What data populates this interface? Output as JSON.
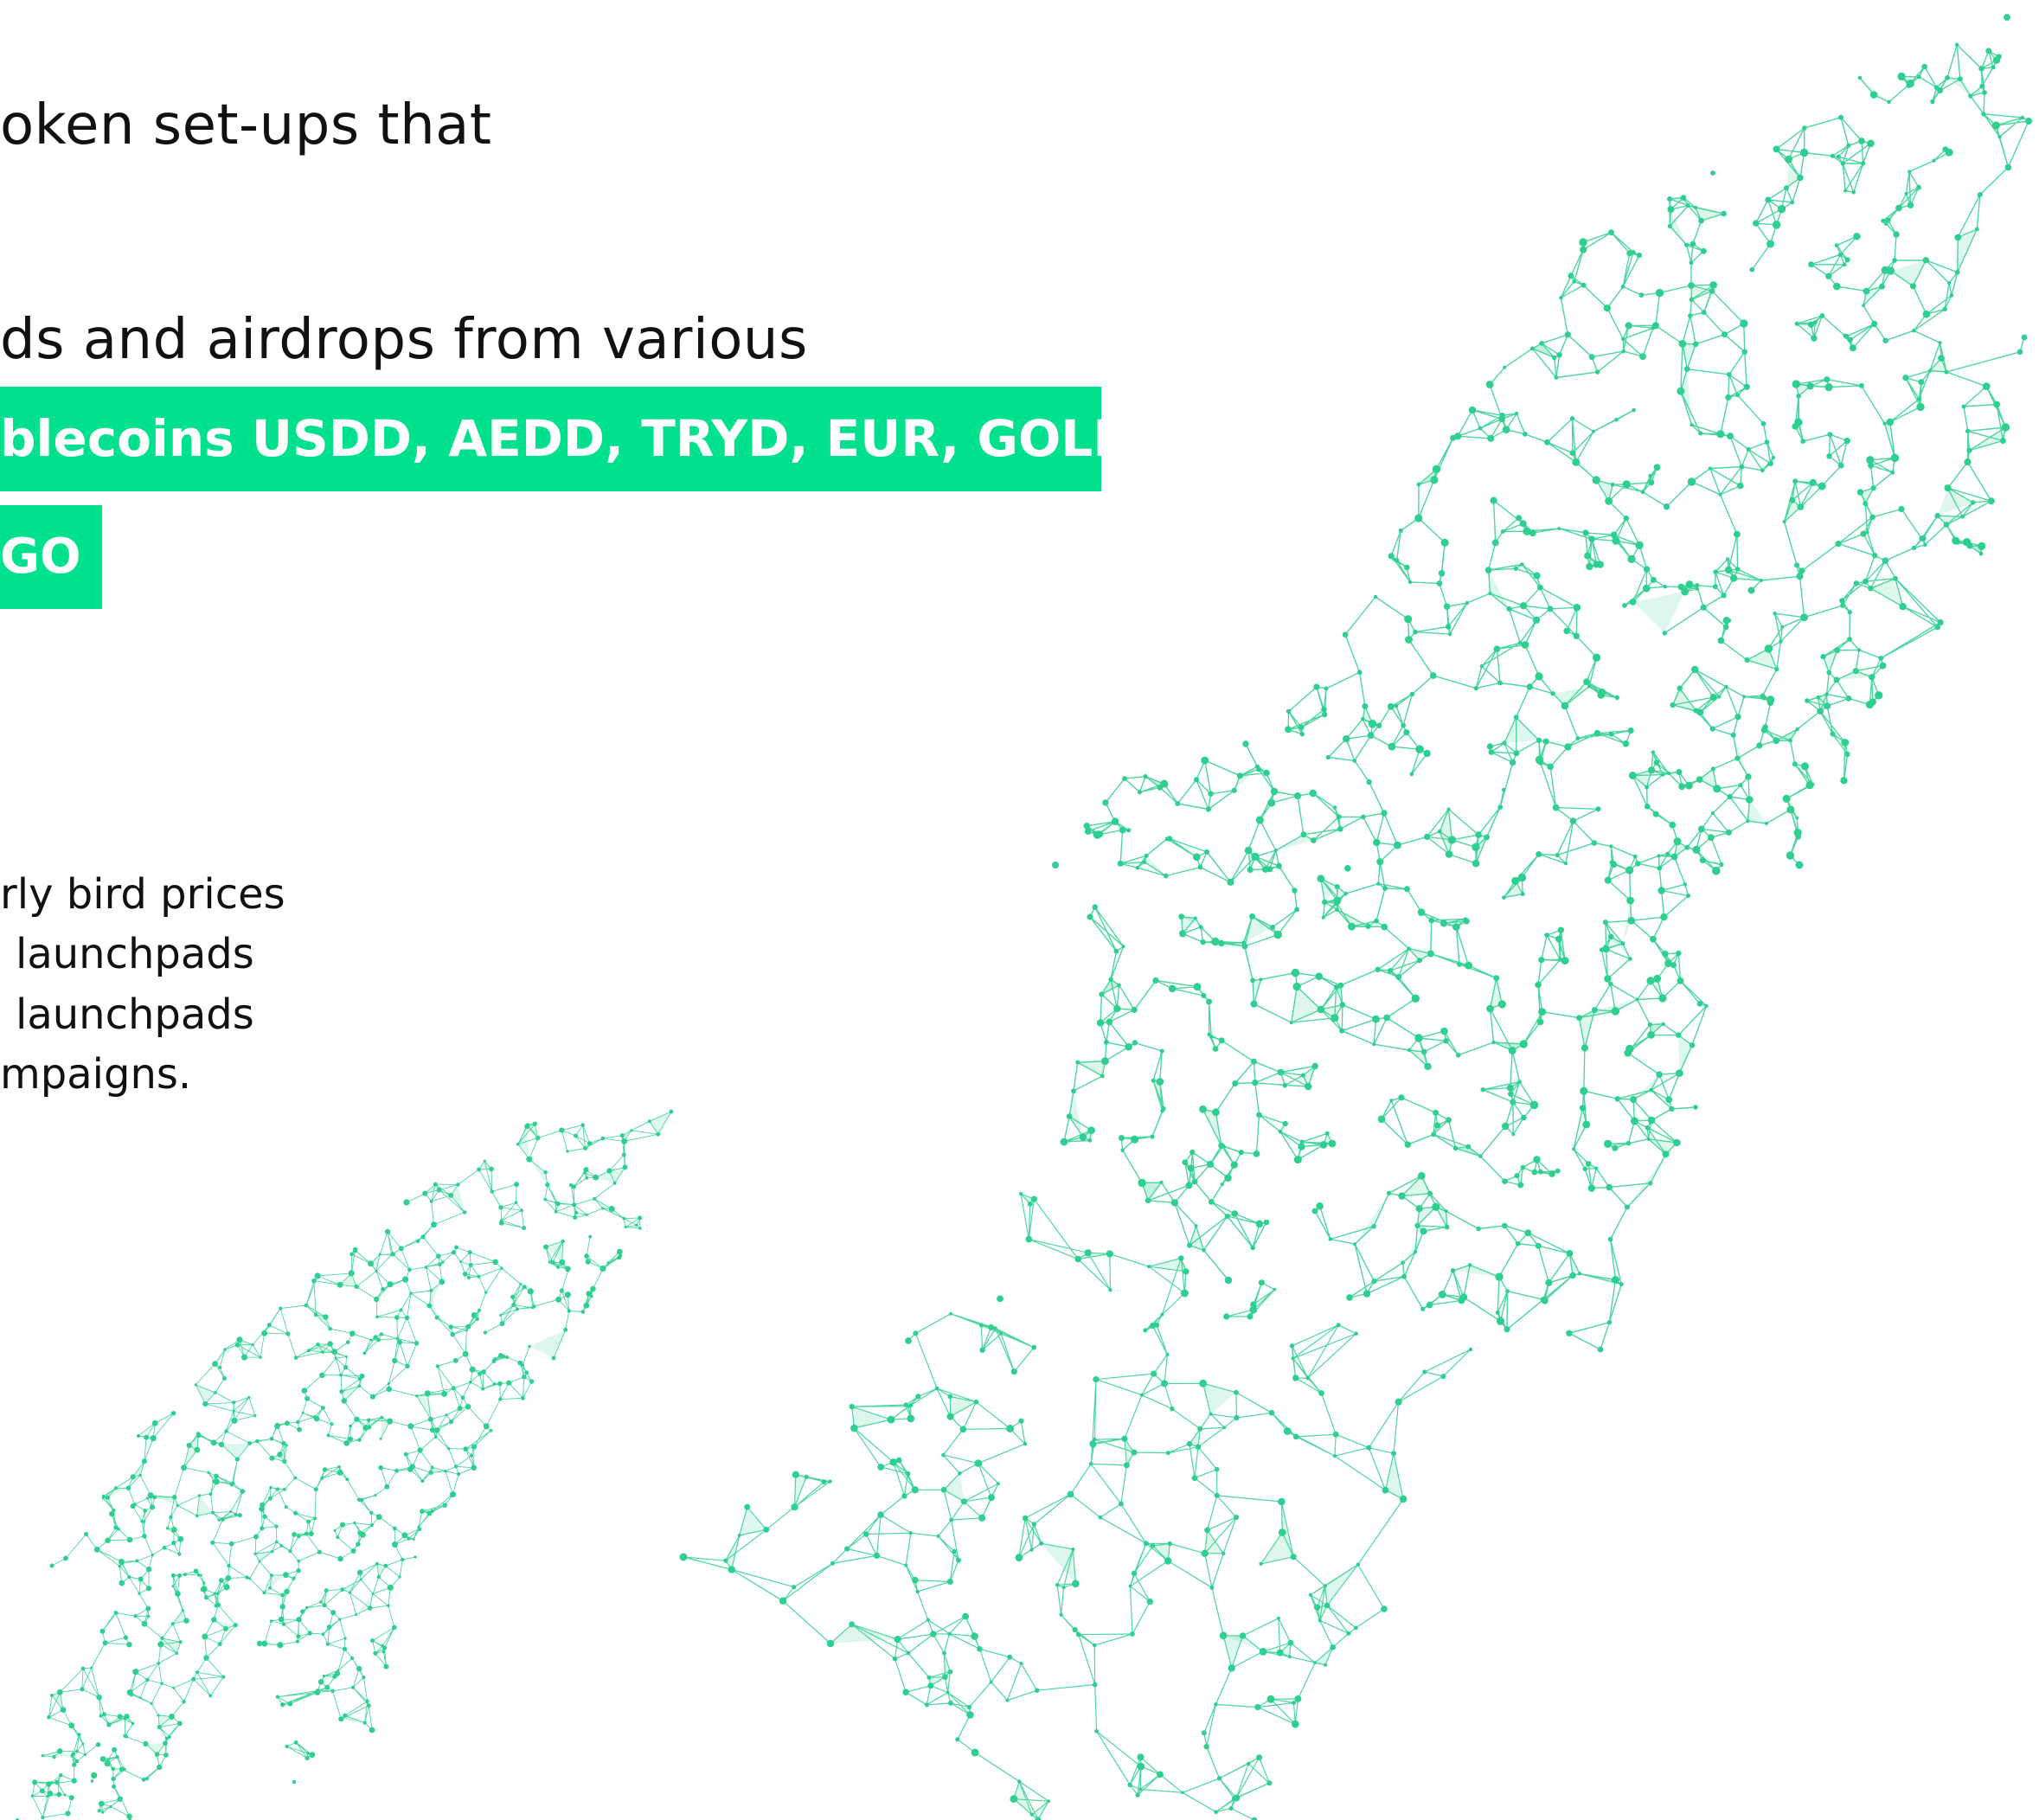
{
  "headline": {
    "line1": "oken set-ups that",
    "line2": "ds and airdrops from various"
  },
  "stablecoins_badge": "blecoins USDD, AEDD, TRYD, EUR, GOLDD",
  "go_badge": "GO",
  "description": {
    "line1": "rly bird prices",
    "line2": "launchpads",
    "line3": "launchpads",
    "line4": "mpaigns."
  },
  "colors": {
    "accent": "#00e08d",
    "network": "#2fcf91",
    "text": "#111111",
    "background": "#ffffff"
  },
  "illustrations": {
    "small_rocket": "rocket-wireframe-icon",
    "large_rocket": "rocket-wireframe-icon"
  }
}
